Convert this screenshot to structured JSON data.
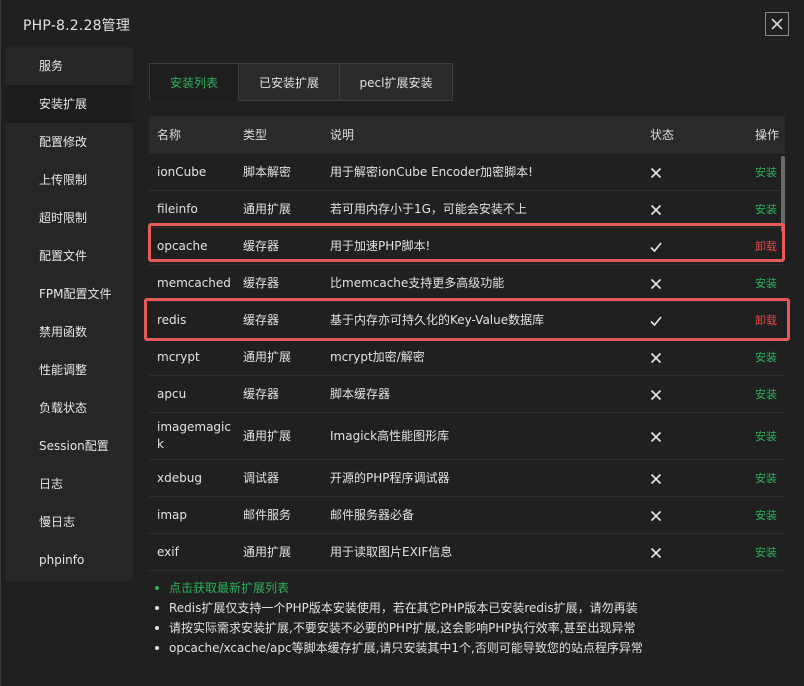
{
  "window": {
    "title": "PHP-8.2.28管理"
  },
  "sidebar": {
    "items": [
      {
        "label": "服务"
      },
      {
        "label": "安装扩展"
      },
      {
        "label": "配置修改"
      },
      {
        "label": "上传限制"
      },
      {
        "label": "超时限制"
      },
      {
        "label": "配置文件"
      },
      {
        "label": "FPM配置文件"
      },
      {
        "label": "禁用函数"
      },
      {
        "label": "性能调整"
      },
      {
        "label": "负载状态"
      },
      {
        "label": "Session配置"
      },
      {
        "label": "日志"
      },
      {
        "label": "慢日志"
      },
      {
        "label": "phpinfo"
      }
    ],
    "active_index": 1
  },
  "tabs": [
    {
      "label": "安装列表"
    },
    {
      "label": "已安装扩展"
    },
    {
      "label": "pecl扩展安装"
    }
  ],
  "table": {
    "headers": {
      "name": "名称",
      "type": "类型",
      "desc": "说明",
      "status": "状态",
      "action": "操作"
    },
    "rows": [
      {
        "name": "ionCube",
        "type": "脚本解密",
        "desc": "用于解密ionCube Encoder加密脚本!",
        "installed": false,
        "action": "安装"
      },
      {
        "name": "fileinfo",
        "type": "通用扩展",
        "desc": "若可用内存小于1G，可能会安装不上",
        "installed": false,
        "action": "安装"
      },
      {
        "name": "opcache",
        "type": "缓存器",
        "desc": "用于加速PHP脚本!",
        "installed": true,
        "action": "卸载"
      },
      {
        "name": "memcached",
        "type": "缓存器",
        "desc": "比memcache支持更多高级功能",
        "installed": false,
        "action": "安装"
      },
      {
        "name": "redis",
        "type": "缓存器",
        "desc": "基于内存亦可持久化的Key-Value数据库",
        "installed": true,
        "action": "卸载"
      },
      {
        "name": "mcrypt",
        "type": "通用扩展",
        "desc": "mcrypt加密/解密",
        "installed": false,
        "action": "安装"
      },
      {
        "name": "apcu",
        "type": "缓存器",
        "desc": "脚本缓存器",
        "installed": false,
        "action": "安装"
      },
      {
        "name": "imagemagick",
        "type": "通用扩展",
        "desc": "Imagick高性能图形库",
        "installed": false,
        "action": "安装"
      },
      {
        "name": "xdebug",
        "type": "调试器",
        "desc": "开源的PHP程序调试器",
        "installed": false,
        "action": "安装"
      },
      {
        "name": "imap",
        "type": "邮件服务",
        "desc": "邮件服务器必备",
        "installed": false,
        "action": "安装"
      },
      {
        "name": "exif",
        "type": "通用扩展",
        "desc": "用于读取图片EXIF信息",
        "installed": false,
        "action": "安装"
      }
    ]
  },
  "notes": [
    "点击获取最新扩展列表",
    "Redis扩展仅支持一个PHP版本安装使用，若在其它PHP版本已安装redis扩展，请勿再装",
    "请按实际需求安装扩展,不要安装不必要的PHP扩展,这会影响PHP执行效率,甚至出现异常",
    "opcache/xcache/apc等脚本缓存扩展,请只安装其中1个,否则可能导致您的站点程序异常"
  ],
  "colors": {
    "accent_green": "#2bb05a",
    "danger_red": "#e04b4b",
    "highlight_border": "#e65a5a",
    "background": "#202020"
  },
  "icons": {
    "installed": "check-icon",
    "not_installed": "cross-icon",
    "close": "close-icon"
  }
}
